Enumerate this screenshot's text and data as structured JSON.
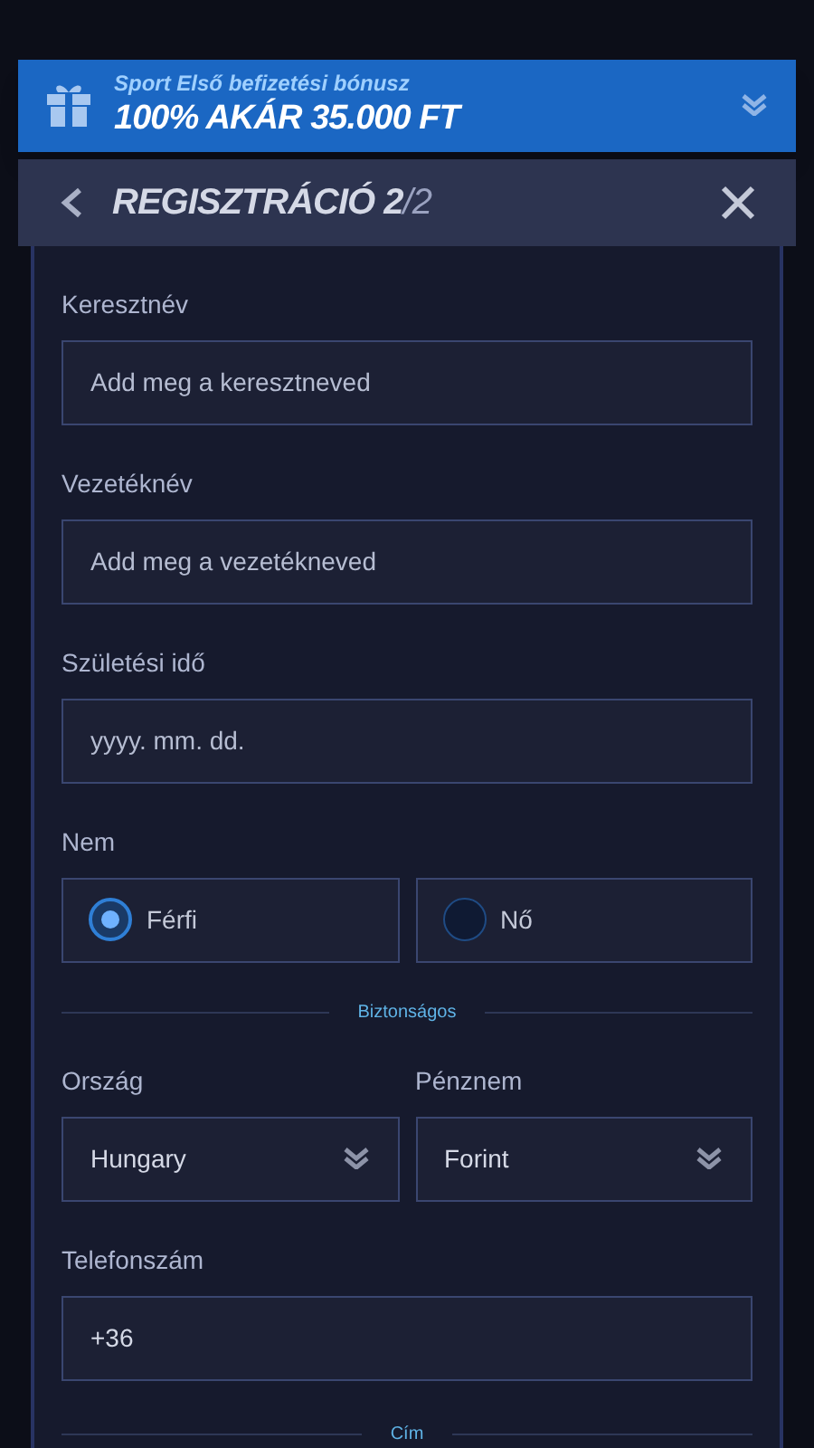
{
  "bonus": {
    "subtitle": "Sport Első befizetési bónusz",
    "title": "100% AKÁR 35.000 FT"
  },
  "header": {
    "title": "REGISZTRÁCIÓ 2",
    "step": "/2"
  },
  "fields": [
    {
      "kind": "text",
      "label": "Keresztnév",
      "placeholder": "Add meg a keresztneved"
    },
    {
      "kind": "text",
      "label": "Vezetéknév",
      "placeholder": "Add meg a vezetékneved"
    },
    {
      "kind": "text",
      "label": "Születési idő",
      "placeholder": "yyyy. mm. dd."
    }
  ],
  "gender": {
    "label": "Nem",
    "options": [
      {
        "label": "Férfi",
        "selected": true
      },
      {
        "label": "Nő",
        "selected": false
      }
    ]
  },
  "divider_1": "Biztonságos",
  "selects": [
    {
      "label": "Ország",
      "value": "Hungary"
    },
    {
      "label": "Pénznem",
      "value": "Forint"
    }
  ],
  "phone": {
    "label": "Telefonszám",
    "value": "+36"
  },
  "divider_2": "Cím"
}
